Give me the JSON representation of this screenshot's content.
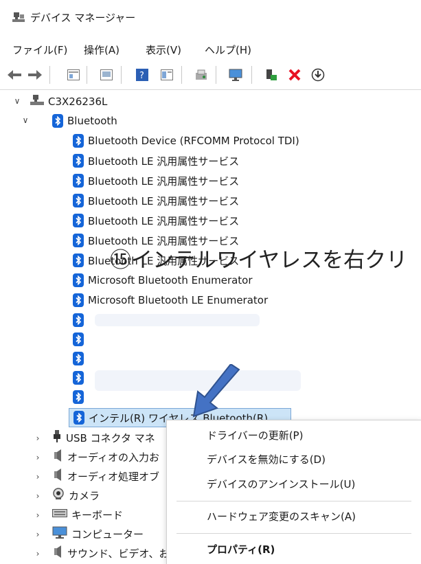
{
  "window": {
    "title": "デバイス マネージャー"
  },
  "menu": [
    "ファイル(F)",
    "操作(A)",
    "表示(V)",
    "ヘルプ(H)"
  ],
  "toolbar_icons": [
    "back-icon",
    "forward-icon",
    "properties-icon",
    "update-driver-icon",
    "help-icon",
    "view-icon",
    "scan-icon",
    "monitor-icon",
    "add-driver-icon",
    "uninstall-icon",
    "download-icon"
  ],
  "tree": {
    "computer": "C3X26236L",
    "bluetooth_category": "Bluetooth",
    "bluetooth_devices": [
      "Bluetooth Device (RFCOMM Protocol TDI)",
      "Bluetooth LE 汎用属性サービス",
      "Bluetooth LE 汎用属性サービス",
      "Bluetooth LE 汎用属性サービス",
      "Bluetooth LE 汎用属性サービス",
      "Bluetooth LE 汎用属性サービス",
      "Bluetooth LE 汎用属性サービス",
      "Microsoft Bluetooth Enumerator",
      "Microsoft Bluetooth LE Enumerator"
    ],
    "selected_device": "インテル(R) ワイヤレス Bluetooth(R)",
    "categories": [
      "USB コネクタ マネ",
      "オーディオの入力お",
      "オーディオ処理オブ",
      "カメラ",
      "キーボード",
      "コンピューター",
      "サウンド、ビデオ、お"
    ]
  },
  "annotation": {
    "text": "⑮インテルワイヤレスを右クリ"
  },
  "context_menu": {
    "items": [
      "ドライバーの更新(P)",
      "デバイスを無効にする(D)",
      "デバイスのアンインストール(U)",
      "ハードウェア変更のスキャン(A)",
      "プロパティ(R)"
    ]
  },
  "colors": {
    "bluetooth_icon": "#1565d8",
    "selection": "#cce4f7",
    "arrow": "#4472c4",
    "delete_icon": "#e81123"
  }
}
